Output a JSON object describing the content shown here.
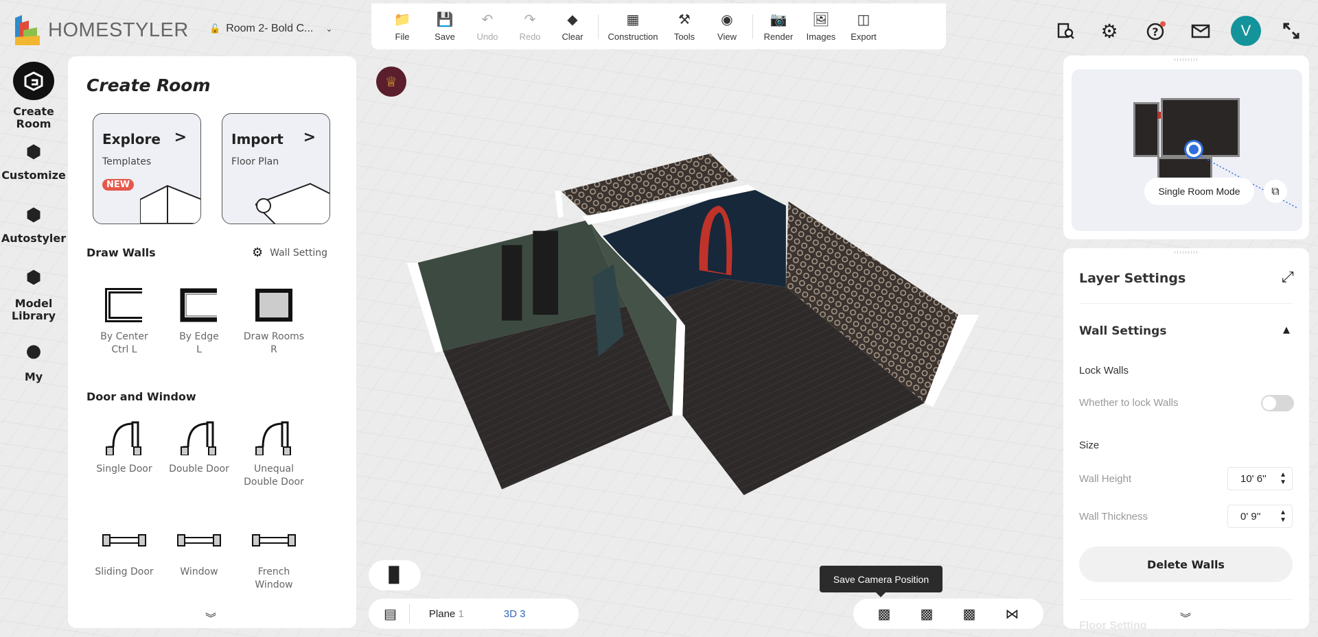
{
  "app": {
    "logo_text": "HOMESTYLER",
    "project_name": "Room 2- Bold C..."
  },
  "toolbar": [
    {
      "label": "File",
      "icon": "folder-icon",
      "enabled": true
    },
    {
      "label": "Save",
      "icon": "save-icon",
      "enabled": true
    },
    {
      "label": "Undo",
      "icon": "undo-icon",
      "enabled": false
    },
    {
      "label": "Redo",
      "icon": "redo-icon",
      "enabled": false
    },
    {
      "label": "Clear",
      "icon": "eraser-icon",
      "enabled": true
    },
    {
      "label": "Construction",
      "icon": "construction-icon",
      "enabled": true
    },
    {
      "label": "Tools",
      "icon": "tools-icon",
      "enabled": true
    },
    {
      "label": "View",
      "icon": "eye-icon",
      "enabled": true
    },
    {
      "label": "Render",
      "icon": "camera-icon",
      "enabled": true
    },
    {
      "label": "Images",
      "icon": "image-icon",
      "enabled": true
    },
    {
      "label": "Export",
      "icon": "export-icon",
      "enabled": true
    }
  ],
  "header_right": {
    "avatar_letter": "V",
    "avatar_color": "#14939a",
    "notification_color": "#e5574b"
  },
  "nav": [
    {
      "label": "Create Room",
      "active": true
    },
    {
      "label": "Customize"
    },
    {
      "label": "Autostyler"
    },
    {
      "label": "Model Library"
    },
    {
      "label": "My"
    }
  ],
  "create_room": {
    "title": "Create Room",
    "cards": [
      {
        "title": "Explore",
        "subtitle": "Templates",
        "badge": "NEW"
      },
      {
        "title": "Import",
        "subtitle": "Floor Plan"
      }
    ],
    "draw_walls": {
      "heading": "Draw Walls",
      "wall_setting": "Wall Setting",
      "items": [
        {
          "label": "By Center",
          "shortcut": "Ctrl L"
        },
        {
          "label": "By Edge",
          "shortcut": "L"
        },
        {
          "label": "Draw Rooms",
          "shortcut": "R"
        }
      ]
    },
    "door_window": {
      "heading": "Door and Window",
      "items": [
        "Single Door",
        "Double Door",
        "Unequal Double Door",
        "Sliding Door",
        "Window",
        "French Window"
      ]
    }
  },
  "minimap": {
    "mode_button": "Single Room Mode"
  },
  "layer": {
    "title": "Layer Settings",
    "wall_settings": "Wall Settings",
    "lock_walls": "Lock Walls",
    "lock_desc": "Whether to lock Walls",
    "lock_on": false,
    "size": "Size",
    "wall_height_label": "Wall Height",
    "wall_height": "10' 6''",
    "wall_thickness_label": "Wall Thickness",
    "wall_thickness": "0' 9''",
    "delete_button": "Delete Walls",
    "next_section": "Floor Setting"
  },
  "bottom": {
    "plane_label": "Plane",
    "plane_count": "1",
    "view3d_label": "3D",
    "view3d_count": "3",
    "tooltip": "Save Camera Position"
  }
}
